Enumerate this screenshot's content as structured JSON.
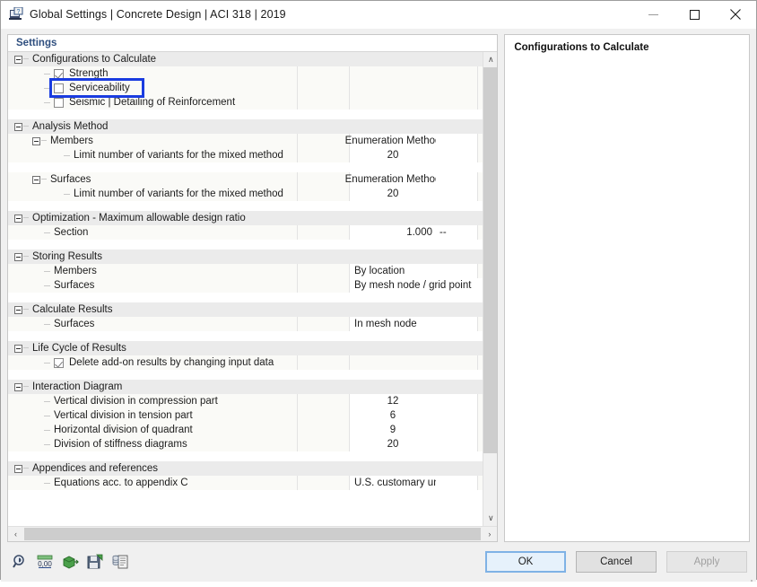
{
  "window": {
    "title": "Global Settings | Concrete Design | ACI 318 | 2019",
    "icon": "app-settings-icon",
    "minimize_label": "—",
    "maximize_label": "□",
    "close_label": "✕"
  },
  "left_pane": {
    "header": "Settings"
  },
  "right_pane": {
    "title": "Configurations to Calculate"
  },
  "tree": [
    {
      "type": "group",
      "label": "Configurations to Calculate"
    },
    {
      "type": "checkbox",
      "label": "Strength",
      "checked": true
    },
    {
      "type": "checkbox",
      "label": "Serviceability",
      "checked": false,
      "highlighted": true
    },
    {
      "type": "checkbox",
      "label": "Seismic | Detailing of Reinforcement",
      "checked": false
    },
    {
      "type": "spacer"
    },
    {
      "type": "group",
      "label": "Analysis Method"
    },
    {
      "type": "subgroup",
      "label": "Members",
      "value": "Enumeration Method"
    },
    {
      "type": "item",
      "label": "Limit number of variants for the mixed method",
      "value": "20",
      "align": "center"
    },
    {
      "type": "spacer"
    },
    {
      "type": "subgroup",
      "label": "Surfaces",
      "value": "Enumeration Method"
    },
    {
      "type": "item",
      "label": "Limit number of variants for the mixed method",
      "value": "20",
      "align": "center"
    },
    {
      "type": "spacer"
    },
    {
      "type": "group",
      "label": "Optimization - Maximum allowable design ratio"
    },
    {
      "type": "item",
      "label": "Section",
      "value": "1.000",
      "unit": "--",
      "align": "right"
    },
    {
      "type": "spacer"
    },
    {
      "type": "group",
      "label": "Storing Results"
    },
    {
      "type": "item",
      "label": "Members",
      "value": "By location",
      "align": "left"
    },
    {
      "type": "item",
      "label": "Surfaces",
      "value": "By mesh node / grid point",
      "align": "left",
      "wide": true
    },
    {
      "type": "spacer"
    },
    {
      "type": "group",
      "label": "Calculate Results"
    },
    {
      "type": "item",
      "label": "Surfaces",
      "value": "In mesh node",
      "align": "left"
    },
    {
      "type": "spacer"
    },
    {
      "type": "group",
      "label": "Life Cycle of Results"
    },
    {
      "type": "checkbox",
      "label": "Delete add-on results by changing input data",
      "checked": true
    },
    {
      "type": "spacer"
    },
    {
      "type": "group",
      "label": "Interaction Diagram"
    },
    {
      "type": "item",
      "label": "Vertical division in compression part",
      "value": "12",
      "align": "center"
    },
    {
      "type": "item",
      "label": "Vertical division in tension part",
      "value": "6",
      "align": "center"
    },
    {
      "type": "item",
      "label": "Horizontal division of quadrant",
      "value": "9",
      "align": "center"
    },
    {
      "type": "item",
      "label": "Division of stiffness diagrams",
      "value": "20",
      "align": "center"
    },
    {
      "type": "spacer"
    },
    {
      "type": "group",
      "label": "Appendices and references"
    },
    {
      "type": "item",
      "label": "Equations acc. to appendix C",
      "value": "U.S. customary units",
      "align": "left",
      "clipped": true
    }
  ],
  "toolbar": [
    {
      "icon": "magnifier-icon",
      "name": "find-button"
    },
    {
      "icon": "decimal-places-icon",
      "name": "decimal-places-button",
      "label": "0,00"
    },
    {
      "icon": "import-icon",
      "name": "import-button"
    },
    {
      "icon": "save-icon",
      "name": "export-button"
    },
    {
      "icon": "units-document-icon",
      "name": "units-button"
    }
  ],
  "footer_buttons": {
    "ok": "OK",
    "cancel": "Cancel",
    "apply": "Apply"
  },
  "scrollbars": {
    "up_arrow": "∧",
    "down_arrow": "∨",
    "left_arrow": "‹",
    "right_arrow": "›"
  },
  "colors": {
    "accent": "#2f4f7f",
    "annotation": "#1a3ce0",
    "group_row": "#ebebeb",
    "child_row": "#fafaf7"
  }
}
